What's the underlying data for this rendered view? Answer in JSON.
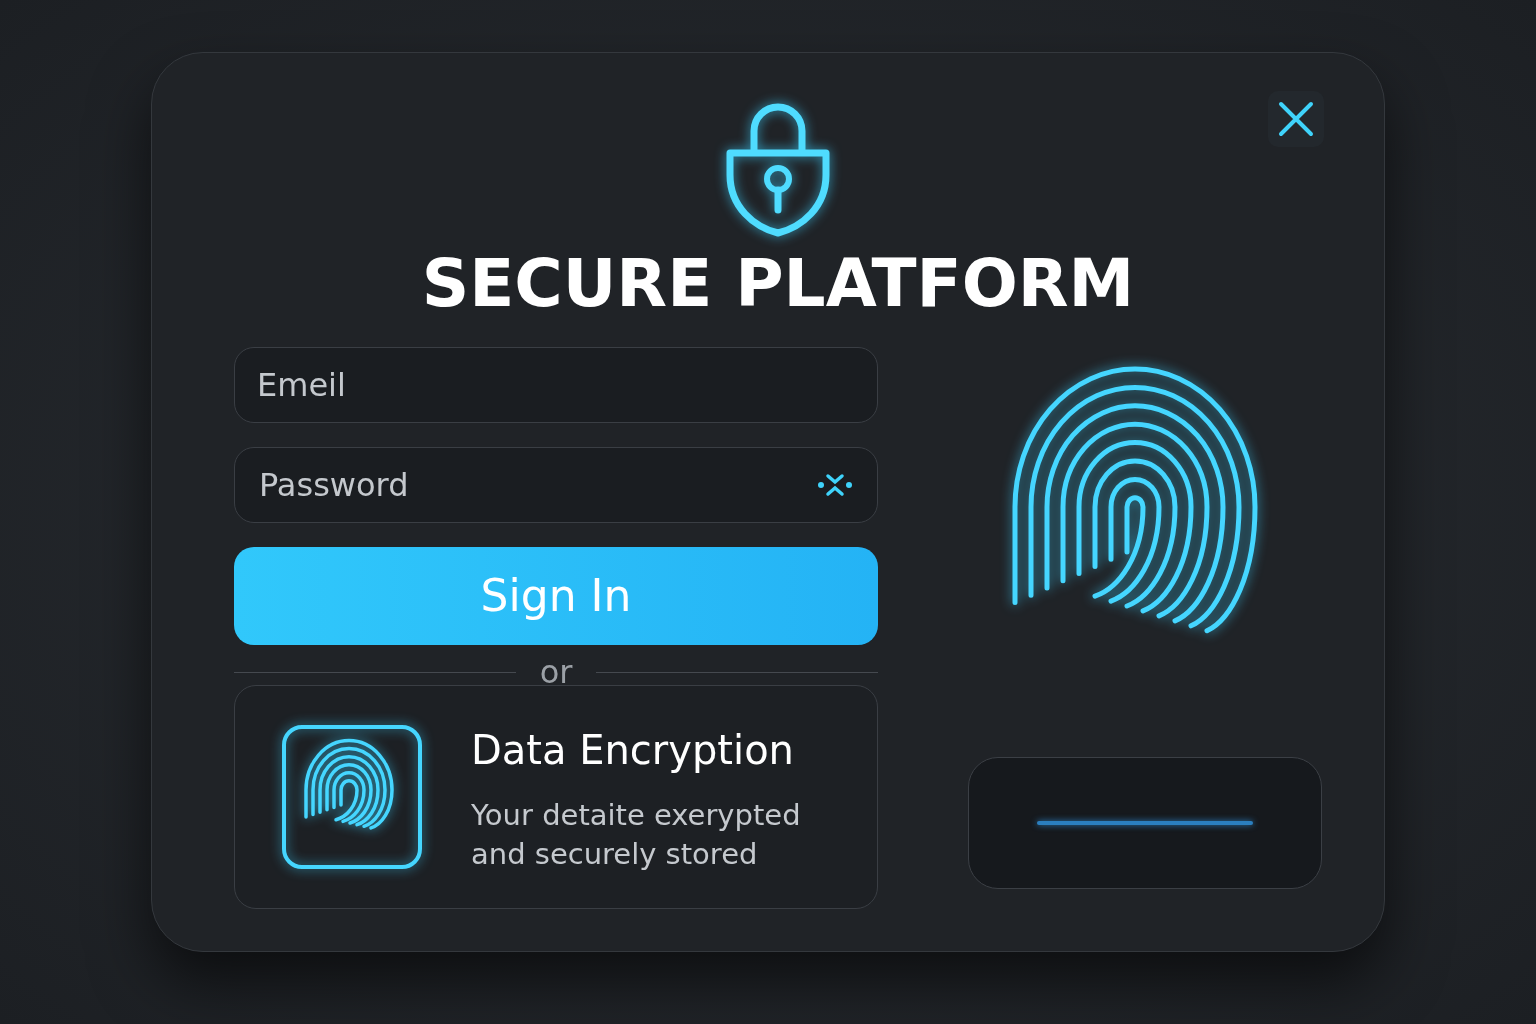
{
  "title": "SECURE PLATFORM",
  "email_field": {
    "placeholder": "Emeil"
  },
  "password_field": {
    "placeholder": "Password"
  },
  "sign_in_button": "Sign In",
  "divider": "or",
  "encryption_card": {
    "title": "Data Encryption",
    "description": "Your detaite exerypted and securely stored"
  }
}
